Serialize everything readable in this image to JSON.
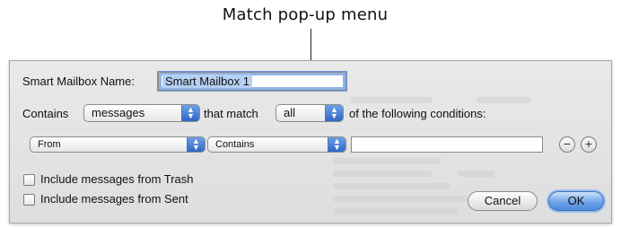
{
  "annotation": {
    "callout_text": "Match pop-up menu"
  },
  "dialog": {
    "name_label": "Smart Mailbox Name:",
    "name_value": "Smart Mailbox 1",
    "contains_label": "Contains",
    "contains_popup": "messages",
    "that_match_label": "that match",
    "match_popup": "all",
    "following_label": "of the following conditions:",
    "condition": {
      "field_popup": "From",
      "operator_popup": "Contains",
      "value": "",
      "remove_symbol": "−",
      "add_symbol": "+"
    },
    "include_trash_label": "Include messages from Trash",
    "include_trash_checked": false,
    "include_sent_label": "Include messages from Sent",
    "include_sent_checked": false,
    "cancel_label": "Cancel",
    "ok_label": "OK"
  },
  "colors": {
    "accent": "#3a7bd5",
    "dialog_bg": "#e4e4e4"
  }
}
